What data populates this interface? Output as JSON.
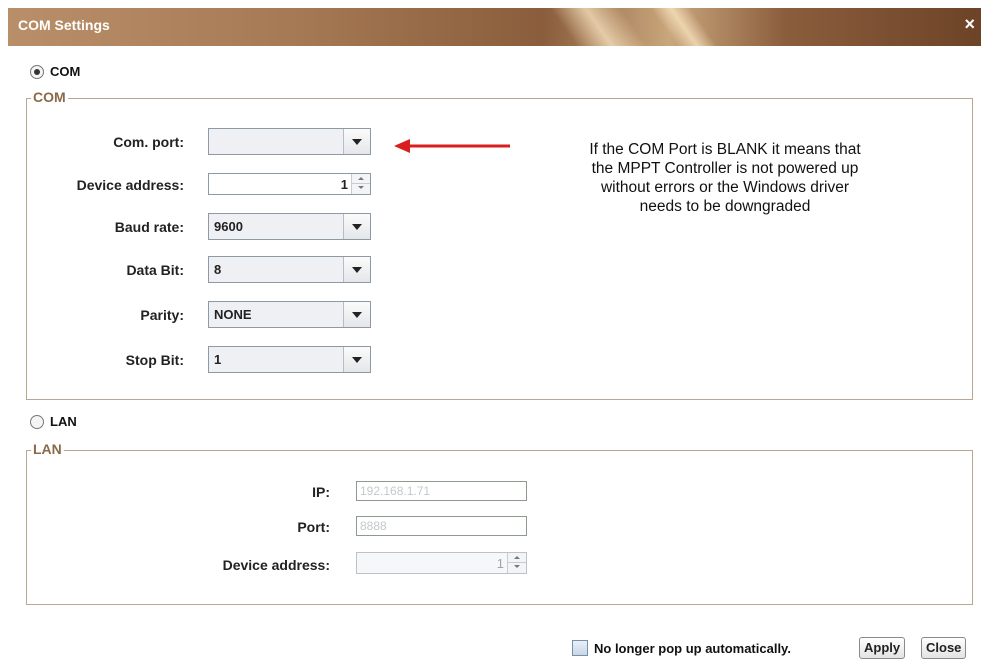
{
  "window": {
    "title": "COM Settings",
    "close_icon": "close-icon"
  },
  "com_radio": {
    "label": "COM",
    "selected": true
  },
  "com_group": {
    "legend": "COM",
    "com_port": {
      "label": "Com. port:",
      "value": ""
    },
    "device_address": {
      "label": "Device address:",
      "value": "1"
    },
    "baud_rate": {
      "label": "Baud rate:",
      "value": "9600"
    },
    "data_bit": {
      "label": "Data Bit:",
      "value": "8"
    },
    "parity": {
      "label": "Parity:",
      "value": "NONE"
    },
    "stop_bit": {
      "label": "Stop Bit:",
      "value": "1"
    }
  },
  "annotation": {
    "lines": [
      "If the COM Port is BLANK it means that",
      "the MPPT Controller is not powered up",
      "without errors or the Windows driver",
      "needs to be downgraded"
    ],
    "arrow_color": "#d81e1e"
  },
  "lan_radio": {
    "label": "LAN",
    "selected": false
  },
  "lan_group": {
    "legend": "LAN",
    "ip": {
      "label": "IP:",
      "value": "192.168.1.71"
    },
    "port": {
      "label": "Port:",
      "value": "8888"
    },
    "device_address": {
      "label": "Device address:",
      "value": "1"
    }
  },
  "footer": {
    "checkbox_label": "No longer pop up automatically.",
    "checkbox_checked": false,
    "apply_label": "Apply",
    "close_label": "Close"
  }
}
